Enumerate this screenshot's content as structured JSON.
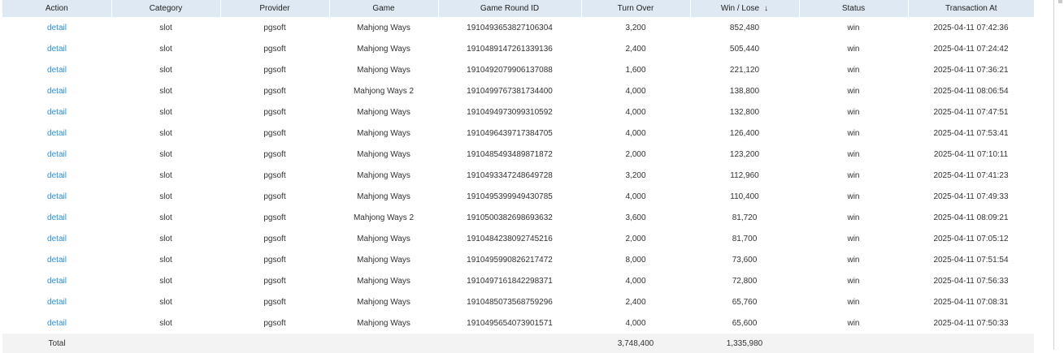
{
  "table": {
    "columns": [
      "Action",
      "Category",
      "Provider",
      "Game",
      "Game Round ID",
      "Turn Over",
      "Win / Lose",
      "Status",
      "Transaction At"
    ],
    "sort_indicator": "↓",
    "rows": [
      {
        "action": "detail",
        "category": "slot",
        "provider": "pgsoft",
        "game": "Mahjong Ways",
        "round_id": "1910493653827106304",
        "turnover": "3,200",
        "winlose": "852,480",
        "status": "win",
        "time": "2025-04-11 07:42:36"
      },
      {
        "action": "detail",
        "category": "slot",
        "provider": "pgsoft",
        "game": "Mahjong Ways",
        "round_id": "1910489147261339136",
        "turnover": "2,400",
        "winlose": "505,440",
        "status": "win",
        "time": "2025-04-11 07:24:42"
      },
      {
        "action": "detail",
        "category": "slot",
        "provider": "pgsoft",
        "game": "Mahjong Ways",
        "round_id": "1910492079906137088",
        "turnover": "1,600",
        "winlose": "221,120",
        "status": "win",
        "time": "2025-04-11 07:36:21"
      },
      {
        "action": "detail",
        "category": "slot",
        "provider": "pgsoft",
        "game": "Mahjong Ways 2",
        "round_id": "1910499767381734400",
        "turnover": "4,000",
        "winlose": "138,800",
        "status": "win",
        "time": "2025-04-11 08:06:54"
      },
      {
        "action": "detail",
        "category": "slot",
        "provider": "pgsoft",
        "game": "Mahjong Ways",
        "round_id": "1910494973099310592",
        "turnover": "4,000",
        "winlose": "132,800",
        "status": "win",
        "time": "2025-04-11 07:47:51"
      },
      {
        "action": "detail",
        "category": "slot",
        "provider": "pgsoft",
        "game": "Mahjong Ways",
        "round_id": "1910496439717384705",
        "turnover": "4,000",
        "winlose": "126,400",
        "status": "win",
        "time": "2025-04-11 07:53:41"
      },
      {
        "action": "detail",
        "category": "slot",
        "provider": "pgsoft",
        "game": "Mahjong Ways",
        "round_id": "1910485493489871872",
        "turnover": "2,000",
        "winlose": "123,200",
        "status": "win",
        "time": "2025-04-11 07:10:11"
      },
      {
        "action": "detail",
        "category": "slot",
        "provider": "pgsoft",
        "game": "Mahjong Ways",
        "round_id": "1910493347248649728",
        "turnover": "3,200",
        "winlose": "112,960",
        "status": "win",
        "time": "2025-04-11 07:41:23"
      },
      {
        "action": "detail",
        "category": "slot",
        "provider": "pgsoft",
        "game": "Mahjong Ways",
        "round_id": "1910495399949430785",
        "turnover": "4,000",
        "winlose": "110,400",
        "status": "win",
        "time": "2025-04-11 07:49:33"
      },
      {
        "action": "detail",
        "category": "slot",
        "provider": "pgsoft",
        "game": "Mahjong Ways 2",
        "round_id": "1910500382698693632",
        "turnover": "3,600",
        "winlose": "81,720",
        "status": "win",
        "time": "2025-04-11 08:09:21"
      },
      {
        "action": "detail",
        "category": "slot",
        "provider": "pgsoft",
        "game": "Mahjong Ways",
        "round_id": "1910484238092745216",
        "turnover": "2,000",
        "winlose": "81,700",
        "status": "win",
        "time": "2025-04-11 07:05:12"
      },
      {
        "action": "detail",
        "category": "slot",
        "provider": "pgsoft",
        "game": "Mahjong Ways",
        "round_id": "1910495990826217472",
        "turnover": "8,000",
        "winlose": "73,600",
        "status": "win",
        "time": "2025-04-11 07:51:54"
      },
      {
        "action": "detail",
        "category": "slot",
        "provider": "pgsoft",
        "game": "Mahjong Ways",
        "round_id": "1910497161842298371",
        "turnover": "4,000",
        "winlose": "72,800",
        "status": "win",
        "time": "2025-04-11 07:56:33"
      },
      {
        "action": "detail",
        "category": "slot",
        "provider": "pgsoft",
        "game": "Mahjong Ways",
        "round_id": "1910485073568759296",
        "turnover": "2,400",
        "winlose": "65,760",
        "status": "win",
        "time": "2025-04-11 07:08:31"
      },
      {
        "action": "detail",
        "category": "slot",
        "provider": "pgsoft",
        "game": "Mahjong Ways",
        "round_id": "1910495654073901571",
        "turnover": "4,000",
        "winlose": "65,600",
        "status": "win",
        "time": "2025-04-11 07:50:33"
      }
    ],
    "footer": {
      "label": "Total",
      "turnover": "3,748,400",
      "winlose": "1,335,980"
    }
  },
  "colors": {
    "header_bg": "#dfe9f3",
    "link": "#2a8fd6",
    "footer_bg": "#f3f3f3"
  }
}
